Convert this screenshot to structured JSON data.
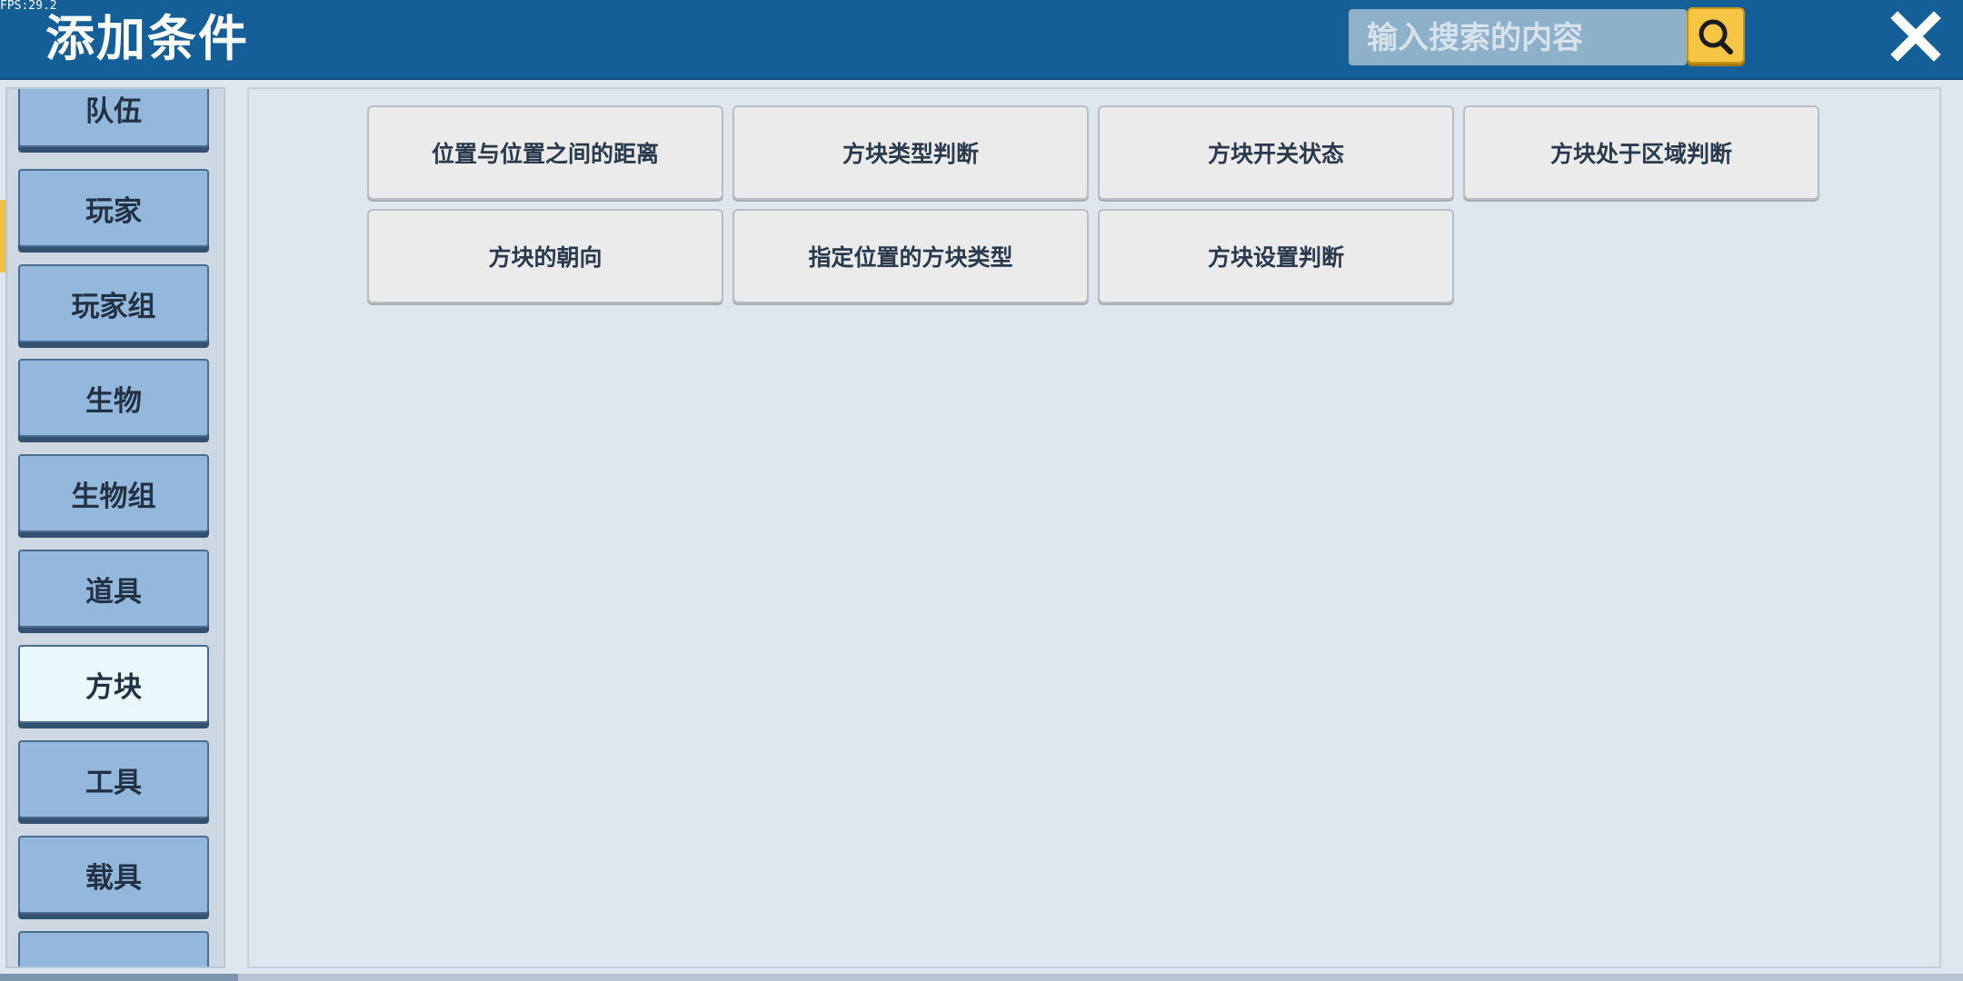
{
  "fps": "FPS:29.2",
  "header": {
    "title": "添加条件",
    "search_placeholder": "输入搜索的内容",
    "search_icon": "search-icon",
    "close_icon": "close-icon"
  },
  "sidebar": {
    "items": [
      {
        "label": "队伍",
        "selected": false
      },
      {
        "label": "玩家",
        "selected": false
      },
      {
        "label": "玩家组",
        "selected": false
      },
      {
        "label": "生物",
        "selected": false
      },
      {
        "label": "生物组",
        "selected": false
      },
      {
        "label": "道具",
        "selected": false
      },
      {
        "label": "方块",
        "selected": true
      },
      {
        "label": "工具",
        "selected": false
      },
      {
        "label": "载具",
        "selected": false
      },
      {
        "label": "",
        "selected": false
      }
    ]
  },
  "conditions": [
    "位置与位置之间的距离",
    "方块类型判断",
    "方块开关状态",
    "方块处于区域判断",
    "方块的朝向",
    "指定位置的方块类型",
    "方块设置判断"
  ],
  "colors": {
    "header": "#155f99",
    "search_button": "#f6c544",
    "sidebar_item": "#93b8dc",
    "sidebar_item_selected": "#eaf8ff",
    "condition_button": "#ebebeb"
  }
}
